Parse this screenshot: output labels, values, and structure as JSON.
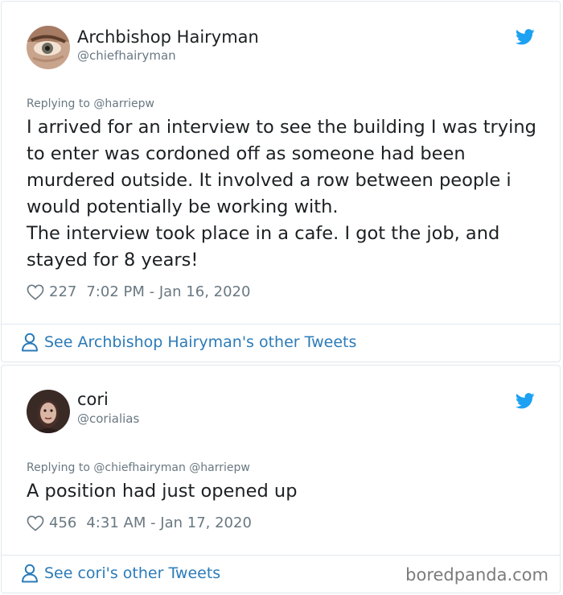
{
  "tweets": [
    {
      "display_name": "Archbishop Hairyman",
      "handle": "@chiefhairyman",
      "replying_to": "Replying to @harriepw",
      "text": "I arrived for an interview to see the building I was trying to enter was cordoned off as someone had been murdered outside. It involved a row between people i would potentially be working with.\nThe interview took place in a cafe. I got the job, and stayed for 8 years!",
      "likes": "227",
      "timestamp": "7:02 PM - Jan 16, 2020",
      "see_more": "See Archbishop Hairyman's other Tweets"
    },
    {
      "display_name": "cori",
      "handle": "@corialias",
      "replying_to": "Replying to @chiefhairyman @harriepw",
      "text": "A position had just opened up",
      "likes": "456",
      "timestamp": "4:31 AM - Jan 17, 2020",
      "see_more": "See cori's other Tweets"
    }
  ],
  "watermark": "boredpanda.com",
  "icons": {
    "brand": "twitter-bird-icon",
    "like": "heart-icon",
    "profile": "person-icon"
  },
  "colors": {
    "twitter_blue": "#1da1f2",
    "link_blue": "#2b7bb9",
    "secondary_text": "#697882",
    "border": "#e1e8ed"
  }
}
